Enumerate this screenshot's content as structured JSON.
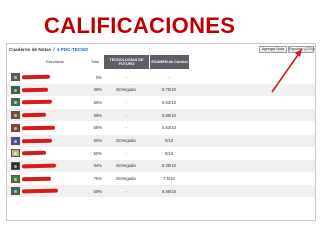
{
  "slide": {
    "title": "CALIFICACIONES"
  },
  "gradebook": {
    "breadcrumb_title": "Cuaderno de Notas",
    "breadcrumb_sep": "/",
    "breadcrumb_course": "4 PDC-TECNO",
    "buttons": {
      "add_grade": "Agregar Nota",
      "export": "Exportar (CSV)"
    },
    "columns": {
      "student": "Estudiante",
      "total": "Total",
      "assignment1": "TECNOLOGÍAS DE FUTURO",
      "assignment2": "EXAMEN de Control"
    },
    "rows": [
      {
        "total": "0%",
        "a1": "-",
        "a2": "-",
        "avatar_color": "#6b5a4a"
      },
      {
        "total": "88%",
        "a1": "Entregada",
        "a2": "8.75/10",
        "avatar_color": "#2e6b3a"
      },
      {
        "total": "56%",
        "a1": "-",
        "a2": "5.63/10",
        "avatar_color": "#3a7a46"
      },
      {
        "total": "69%",
        "a1": "-",
        "a2": "6.88/10",
        "avatar_color": "#7a4a3a"
      },
      {
        "total": "56%",
        "a1": "-",
        "a2": "5.63/10",
        "avatar_color": "#9a3a2a"
      },
      {
        "total": "50%",
        "a1": "Entregada",
        "a2": "0/10",
        "avatar_color": "#4a4a9a"
      },
      {
        "total": "50%",
        "a1": "-",
        "a2": "0/10",
        "avatar_color": "#c9b37a"
      },
      {
        "total": "84%",
        "a1": "Entregada",
        "a2": "8.38/10",
        "avatar_color": "#2a2a2a"
      },
      {
        "total": "75%",
        "a1": "Entregada",
        "a2": "7.5/10",
        "avatar_color": "#4a7a3a"
      },
      {
        "total": "69%",
        "a1": "-",
        "a2": "6.88/10",
        "avatar_color": "#3a6a5a"
      }
    ]
  },
  "colors": {
    "title": "#c00000",
    "redaction": "#d61b1b",
    "header_dark": "#5c5f66",
    "link": "#1a5fb4"
  }
}
